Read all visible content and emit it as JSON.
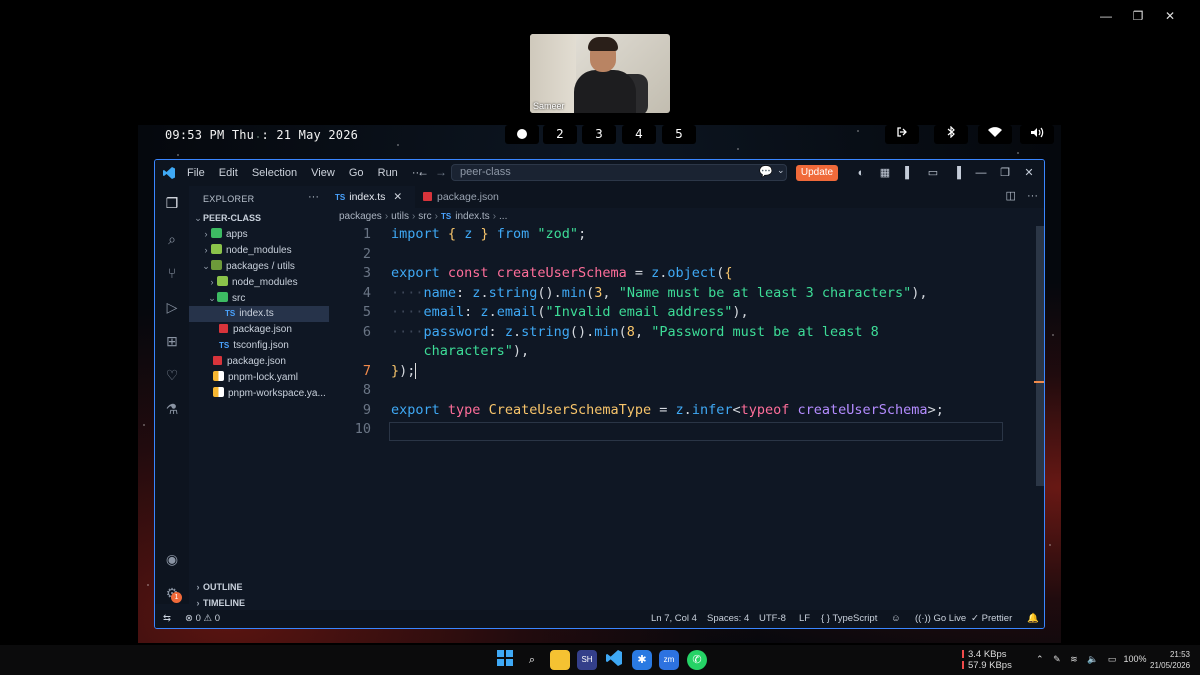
{
  "window_controls": {
    "minimize": "—",
    "restore": "❐",
    "close": "✕"
  },
  "webcam": {
    "name": "Sameer"
  },
  "topbar": {
    "clock": "09:53 PM Thu : 21 May 2026",
    "workspaces": [
      "2",
      "3",
      "4",
      "5"
    ],
    "tray_icons": [
      "logout-icon",
      "bluetooth-icon",
      "wifi-icon",
      "volume-icon"
    ]
  },
  "vscode": {
    "menu": [
      "File",
      "Edit",
      "Selection",
      "View",
      "Go",
      "Run",
      "···"
    ],
    "search_text": "peer-class",
    "update_label": "Update",
    "sidebar": {
      "title": "EXPLORER",
      "more": "···",
      "root": "PEER-CLASS",
      "items": [
        {
          "label": "apps",
          "chev": "›"
        },
        {
          "label": "node_modules",
          "chev": "›"
        },
        {
          "label": "packages / utils",
          "chev": "⌄"
        },
        {
          "label": "node_modules",
          "chev": "›"
        },
        {
          "label": "src",
          "chev": "⌄"
        },
        {
          "label": "index.ts"
        },
        {
          "label": "package.json"
        },
        {
          "label": "tsconfig.json"
        },
        {
          "label": "package.json"
        },
        {
          "label": "pnpm-lock.yaml"
        },
        {
          "label": "pnpm-workspace.ya..."
        }
      ],
      "outline": "OUTLINE",
      "timeline": "TIMELINE",
      "accounts_badge": "1"
    },
    "tabs": [
      {
        "label": "index.ts",
        "icon": "TS",
        "close": "✕"
      },
      {
        "label": "package.json"
      }
    ],
    "breadcrumb": [
      "packages",
      "utils",
      "src",
      "index.ts",
      "..."
    ],
    "breadcrumb_ts": "TS",
    "line_numbers": [
      "1",
      "2",
      "3",
      "4",
      "5",
      "6",
      "",
      "7",
      "8",
      "9",
      "10"
    ],
    "status": {
      "errors": "0",
      "warnings": "0",
      "position": "Ln 7, Col 4",
      "spaces": "Spaces: 4",
      "encoding": "UTF-8",
      "eol": "LF",
      "language": "TypeScript",
      "golive": "Go Live",
      "prettier": "Prettier"
    }
  },
  "taskbar": {
    "net_up": "3.4 KBps",
    "net_down": "57.9 KBps",
    "battery": "100%",
    "time": "21:53",
    "date": "21/05/2026"
  },
  "colors": {
    "accent": "#3a86ff",
    "update": "#f06a3a"
  }
}
